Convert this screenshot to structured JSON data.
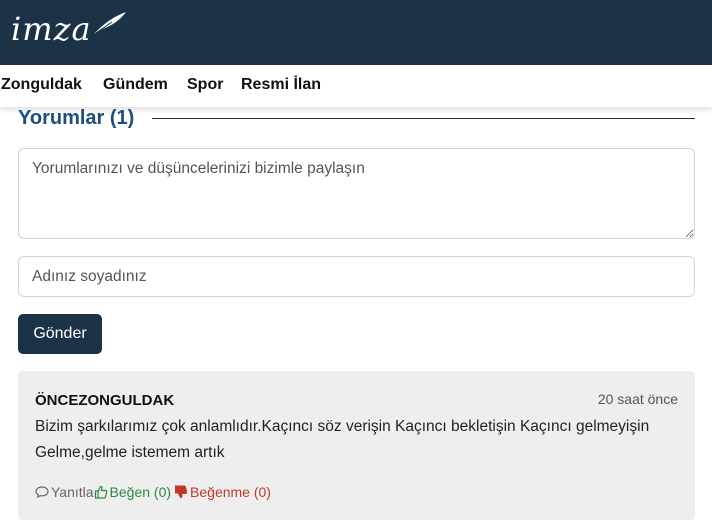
{
  "header": {
    "logo_text": "imza",
    "brand_color": "#1c3347"
  },
  "nav": {
    "items": [
      {
        "label": "Zonguldak"
      },
      {
        "label": "Gündem"
      },
      {
        "label": "Spor"
      },
      {
        "label": "Resmi İlan"
      }
    ]
  },
  "comments_section": {
    "title": "Yorumlar (1)",
    "comment_placeholder": "Yorumlarınızı ve düşüncelerinizi bizimle paylaşın",
    "name_placeholder": "Adınız soyadınız",
    "submit_label": "Gönder"
  },
  "comments": [
    {
      "author": "ÖNCEZONGULDAK",
      "time": "20 saat önce",
      "text": "Bizim şarkılarımız çok anlamlıdır.Kaçıncı söz verişin Kaçıncı bekletişin Kaçıncı gelmeyişin Gelme,gelme istemem artık",
      "reply_label": "Yanıtla",
      "like_label": "Beğen (0)",
      "dislike_label": "Beğenme (0)",
      "like_color": "#2a8a3e",
      "dislike_color": "#c0392b"
    }
  ]
}
